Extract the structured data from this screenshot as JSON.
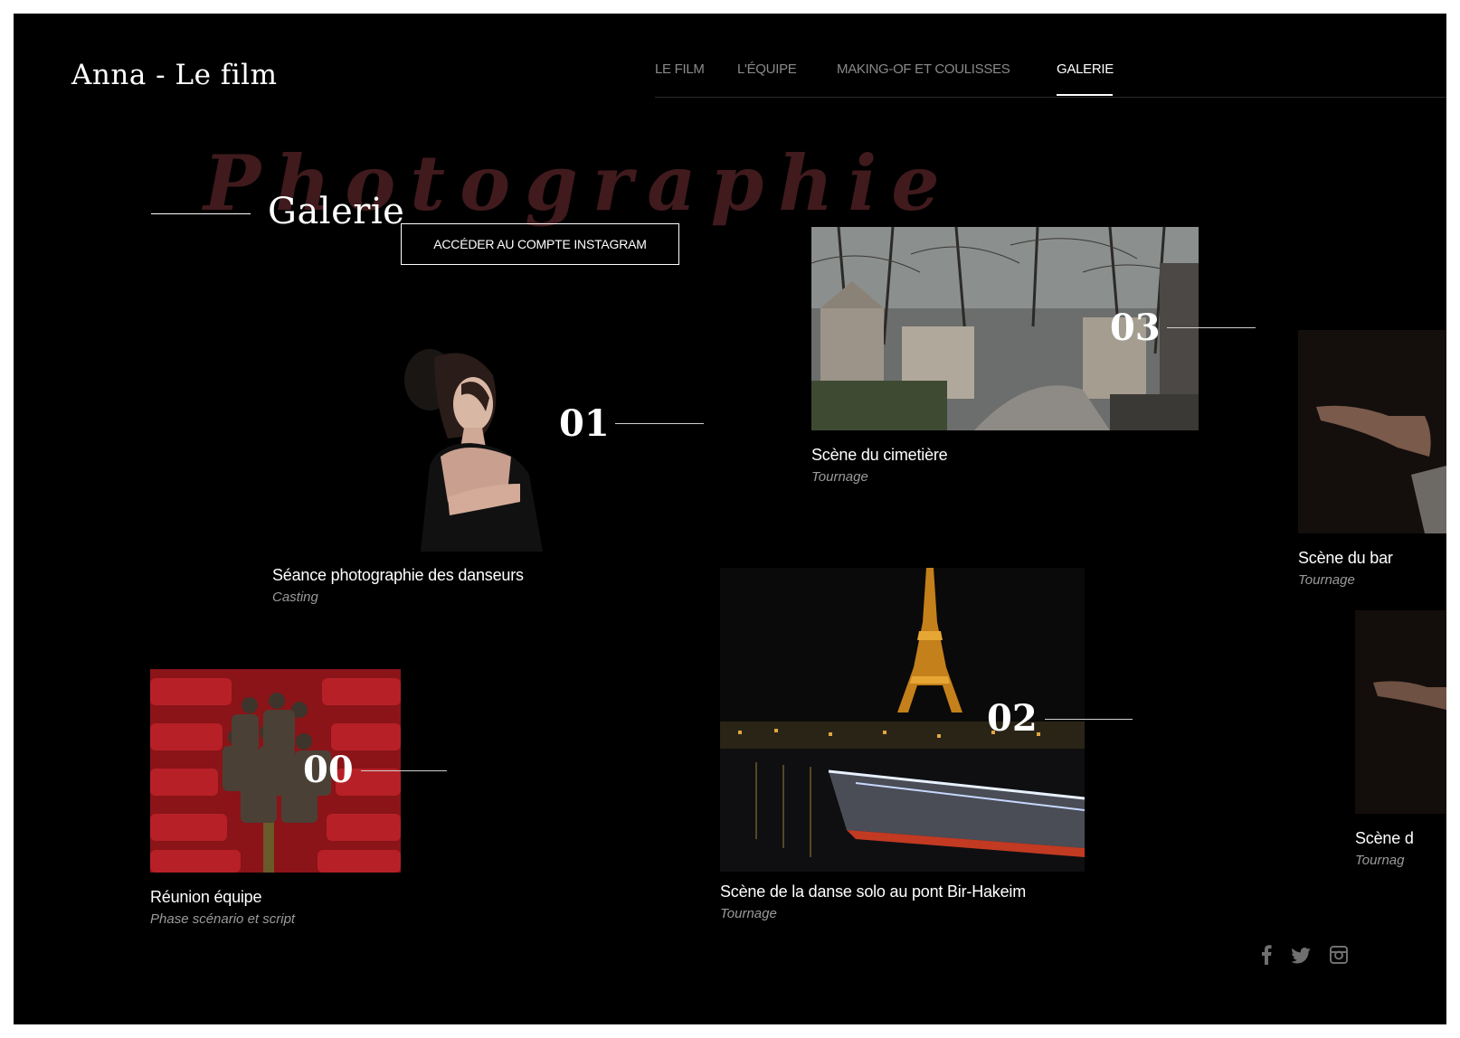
{
  "brand": "Anna - Le film",
  "nav": {
    "items": [
      "LE FILM",
      "L'ÉQUIPE",
      "MAKING-OF ET COULISSES",
      "GALERIE"
    ],
    "active": "GALERIE"
  },
  "hero": {
    "background_word": "Photographie",
    "title": "Galerie",
    "instagram_button": "ACCÉDER AU COMPTE INSTAGRAM"
  },
  "gallery": [
    {
      "number": "00",
      "title": "Réunion équipe",
      "subtitle": "Phase scénario et script"
    },
    {
      "number": "01",
      "title": "Séance photographie des danseurs",
      "subtitle": "Casting"
    },
    {
      "number": "02",
      "title": "Scène de la danse solo au pont Bir-Hakeim",
      "subtitle": "Tournage"
    },
    {
      "number": "03",
      "title": "Scène du cimetière",
      "subtitle": "Tournage"
    },
    {
      "number": "",
      "title": "Scène du bar",
      "subtitle": "Tournage"
    },
    {
      "number": "",
      "title": "Scène d",
      "subtitle": "Tournag"
    }
  ],
  "social": [
    "facebook-icon",
    "twitter-icon",
    "instagram-icon"
  ],
  "colors": {
    "background": "#000000",
    "text": "#ffffff",
    "muted": "#9a9a9a",
    "accent_word": "#401a1d"
  }
}
